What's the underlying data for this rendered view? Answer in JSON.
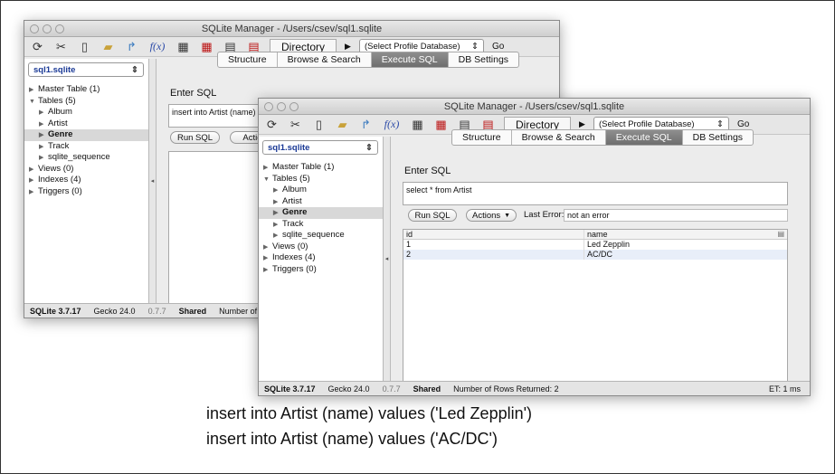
{
  "back": {
    "title": "SQLite Manager - /Users/csev/sql1.sqlite",
    "toolbar": {
      "fx": "f(x)",
      "directory": "Directory",
      "profile": "(Select Profile Database)",
      "go": "Go"
    },
    "db": "sql1.sqlite",
    "tree": [
      "Master Table (1)",
      "Tables (5)",
      "Album",
      "Artist",
      "Genre",
      "Track",
      "sqlite_sequence",
      "Views (0)",
      "Indexes (4)",
      "Triggers (0)"
    ],
    "tabs": [
      "Structure",
      "Browse & Search",
      "Execute SQL",
      "DB Settings"
    ],
    "enter_sql": "Enter SQL",
    "sql": "insert into Artist (name) v",
    "run": "Run SQL",
    "actions": "Actions",
    "status": {
      "version": "SQLite 3.7.17",
      "gecko": "Gecko 24.0",
      "ext": "0.7.7",
      "shared": "Shared",
      "rows": "Number of R"
    }
  },
  "front": {
    "title": "SQLite Manager - /Users/csev/sql1.sqlite",
    "toolbar": {
      "fx": "f(x)",
      "directory": "Directory",
      "profile": "(Select Profile Database)",
      "go": "Go"
    },
    "db": "sql1.sqlite",
    "tree": [
      "Master Table (1)",
      "Tables (5)",
      "Album",
      "Artist",
      "Genre",
      "Track",
      "sqlite_sequence",
      "Views (0)",
      "Indexes (4)",
      "Triggers (0)"
    ],
    "tabs": [
      "Structure",
      "Browse & Search",
      "Execute SQL",
      "DB Settings"
    ],
    "enter_sql": "Enter SQL",
    "sql": "select * from Artist",
    "run": "Run SQL",
    "actions": "Actions",
    "last_error_label": "Last Error:",
    "last_error": "not an error",
    "columns": [
      "id",
      "name"
    ],
    "rows": [
      [
        "1",
        "Led Zepplin"
      ],
      [
        "2",
        "AC/DC"
      ]
    ],
    "status": {
      "version": "SQLite 3.7.17",
      "gecko": "Gecko 24.0",
      "ext": "0.7.7",
      "shared": "Shared",
      "rows": "Number of Rows Returned: 2",
      "et": "ET: 1 ms"
    }
  },
  "caption": [
    "insert into Artist (name) values ('Led Zepplin')",
    "insert into Artist (name) values ('AC/DC')"
  ]
}
